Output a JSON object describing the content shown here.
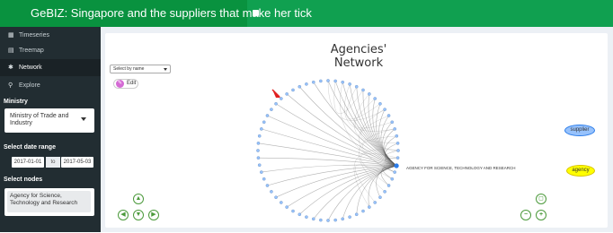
{
  "app": {
    "title": "GeBIZ: Singapore and the suppliers that make her tick",
    "toggle_icon": "square-icon"
  },
  "sidebar": {
    "items": [
      {
        "label": "Timeseries",
        "icon": "calendar-icon",
        "active": false
      },
      {
        "label": "Treemap",
        "icon": "grid-icon",
        "active": false
      },
      {
        "label": "Network",
        "icon": "asterisk-icon",
        "active": true
      },
      {
        "label": "Explore",
        "icon": "search-icon",
        "active": false
      }
    ],
    "ministry_label": "Ministry",
    "ministry_value": "Ministry of Trade and Industry",
    "date_label": "Select date range",
    "date_start": "2017-01-01",
    "date_to": "to",
    "date_end": "2017-05-03",
    "nodes_label": "Select nodes",
    "nodes_value": "Agency for Science, Technology and Research"
  },
  "main": {
    "title": "Agencies' Network",
    "select_placeholder": "Select by name",
    "edit_label": "Edit",
    "highlight_node_label": "AGENCY FOR SCIENCE, TECHNOLOGY AND RESEARCH",
    "legend": {
      "supplier": "supplier",
      "agency": "agency"
    },
    "colors": {
      "supplier": "#97c2fc",
      "agency": "#ffff00",
      "brand": "#10a050",
      "sidebar": "#222d32",
      "nav_buttons": "#4c9a3c"
    }
  }
}
